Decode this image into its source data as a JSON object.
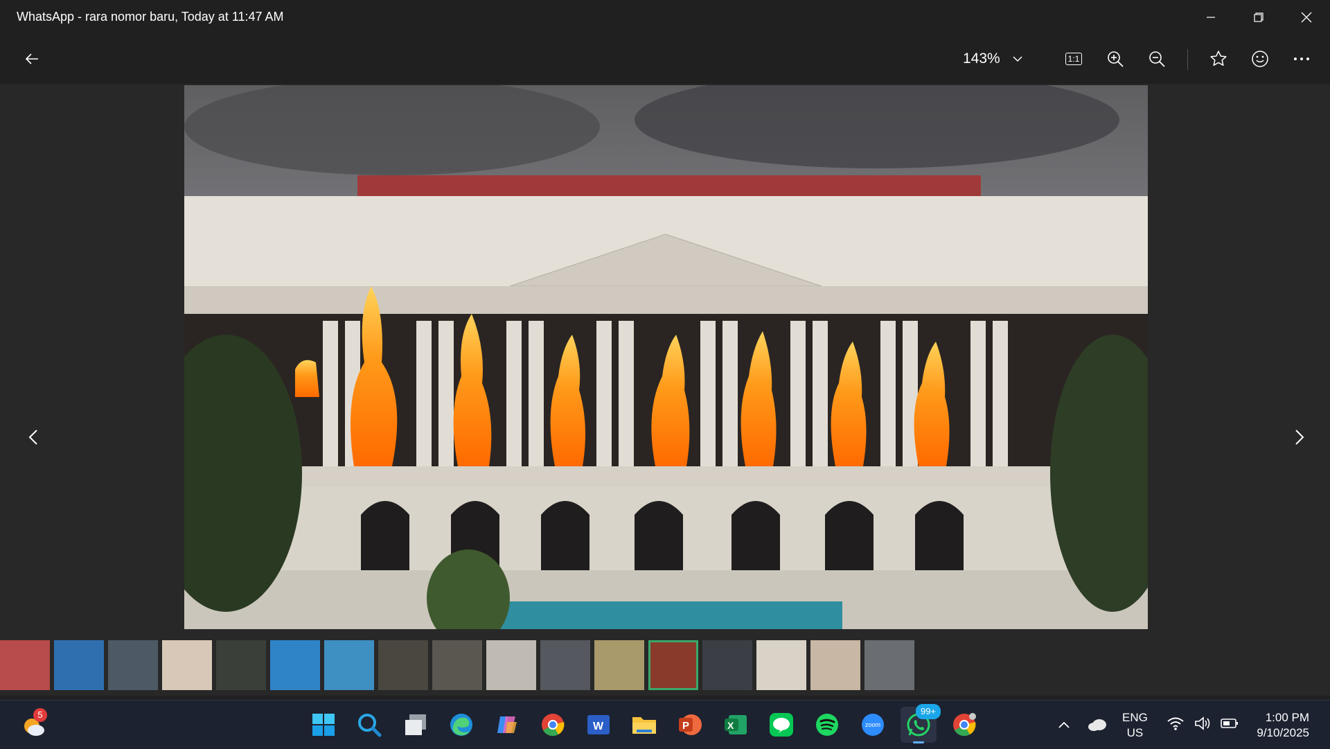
{
  "window": {
    "title": "WhatsApp - rara nomor baru, Today at 11:47 AM"
  },
  "toolbar": {
    "zoom_level": "143%",
    "actual_size_label": "1:1"
  },
  "photo": {
    "description_icon": "burning-building-photo"
  },
  "filmstrip": {
    "count": 17,
    "selected_index": 12
  },
  "taskbar": {
    "weather_badge": "5",
    "whatsapp_badge": "99+",
    "powerpoint_letter": "P",
    "excel_letter": "X",
    "word_letter": "W",
    "zoom_label": "zoom",
    "lang_line1": "ENG",
    "lang_line2": "US",
    "time": "1:00 PM",
    "date": "9/10/2025"
  },
  "colors": {
    "accent": "#3aa86a",
    "taskbar": "#1c2230",
    "badge": "#e23b3b"
  }
}
